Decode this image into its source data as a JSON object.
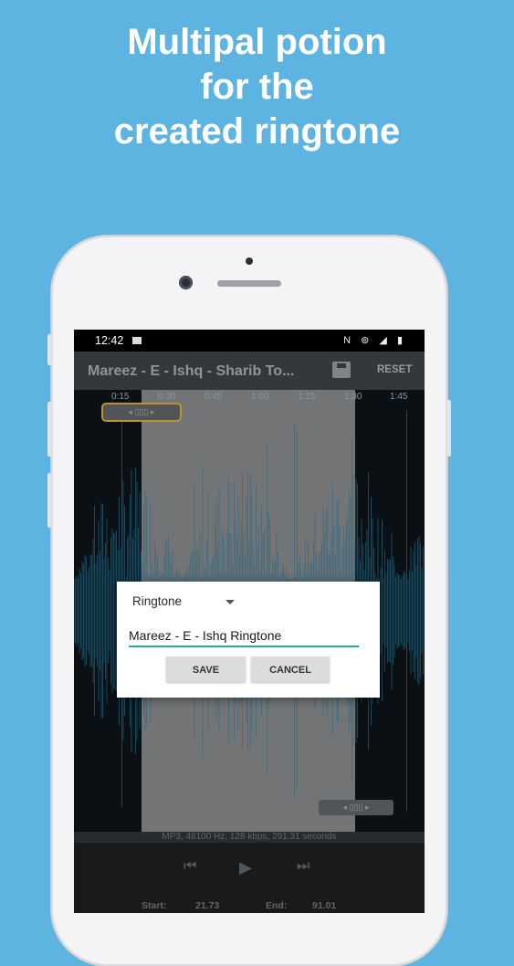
{
  "headline": [
    "Multipal potion",
    "for the",
    "created ringtone"
  ],
  "status_bar": {
    "time": "12:42",
    "icons": "N ⊚ ◢ ▮"
  },
  "toolbar": {
    "title": "Mareez - E - Ishq - Sharib To...",
    "reset_label": "RESET"
  },
  "timeline": {
    "ticks": [
      "0:15",
      "0:30",
      "0:45",
      "1:00",
      "1:15",
      "1:30",
      "1:45"
    ]
  },
  "file_info": "MP3, 48100 Hz, 128 kbps, 291.31 seconds",
  "playback": {
    "prev_symbol": "⏮",
    "play_symbol": "▶",
    "next_symbol": "⏭",
    "start_label": "Start:",
    "start_value": "21.73",
    "end_label": "End:",
    "end_value": "91.01"
  },
  "dialog": {
    "type_selected": "Ringtone",
    "name_value": "Mareez - E - Ishq Ringtone",
    "save_label": "SAVE",
    "cancel_label": "CANCEL"
  },
  "colors": {
    "background": "#5db4e0",
    "accent": "#20b0a8",
    "waveform": "#1e6d8c"
  }
}
